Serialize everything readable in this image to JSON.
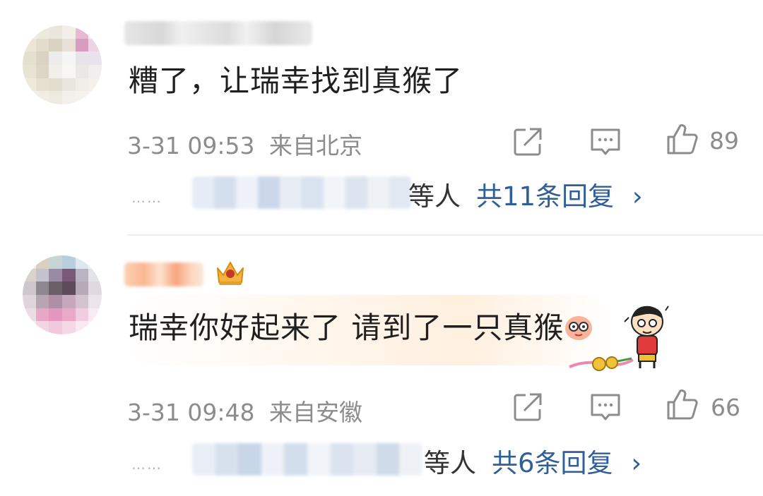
{
  "comments": [
    {
      "text": "糟了，让瑞幸找到真猴了",
      "time": "3-31 09:53",
      "location": "来自北京",
      "likes": "89",
      "replies": {
        "suffix": "等人",
        "more": "共11条回复",
        "chevron": "›"
      }
    },
    {
      "text": "瑞幸你好起来了 请到了一只真猴",
      "time": "3-31 09:48",
      "location": "来自安徽",
      "likes": "66",
      "replies": {
        "suffix": "等人",
        "more": "共6条回复",
        "chevron": "›"
      }
    }
  ],
  "icons": {
    "share": "share-icon",
    "comment": "comment-icon",
    "like": "thumbs-up-icon",
    "badge": "crown-badge-icon",
    "sticker": "cartoon-boy-sticker"
  },
  "colors": {
    "link": "#2f5f96",
    "meta": "#8c8c8c",
    "text": "#1f1f1f"
  }
}
